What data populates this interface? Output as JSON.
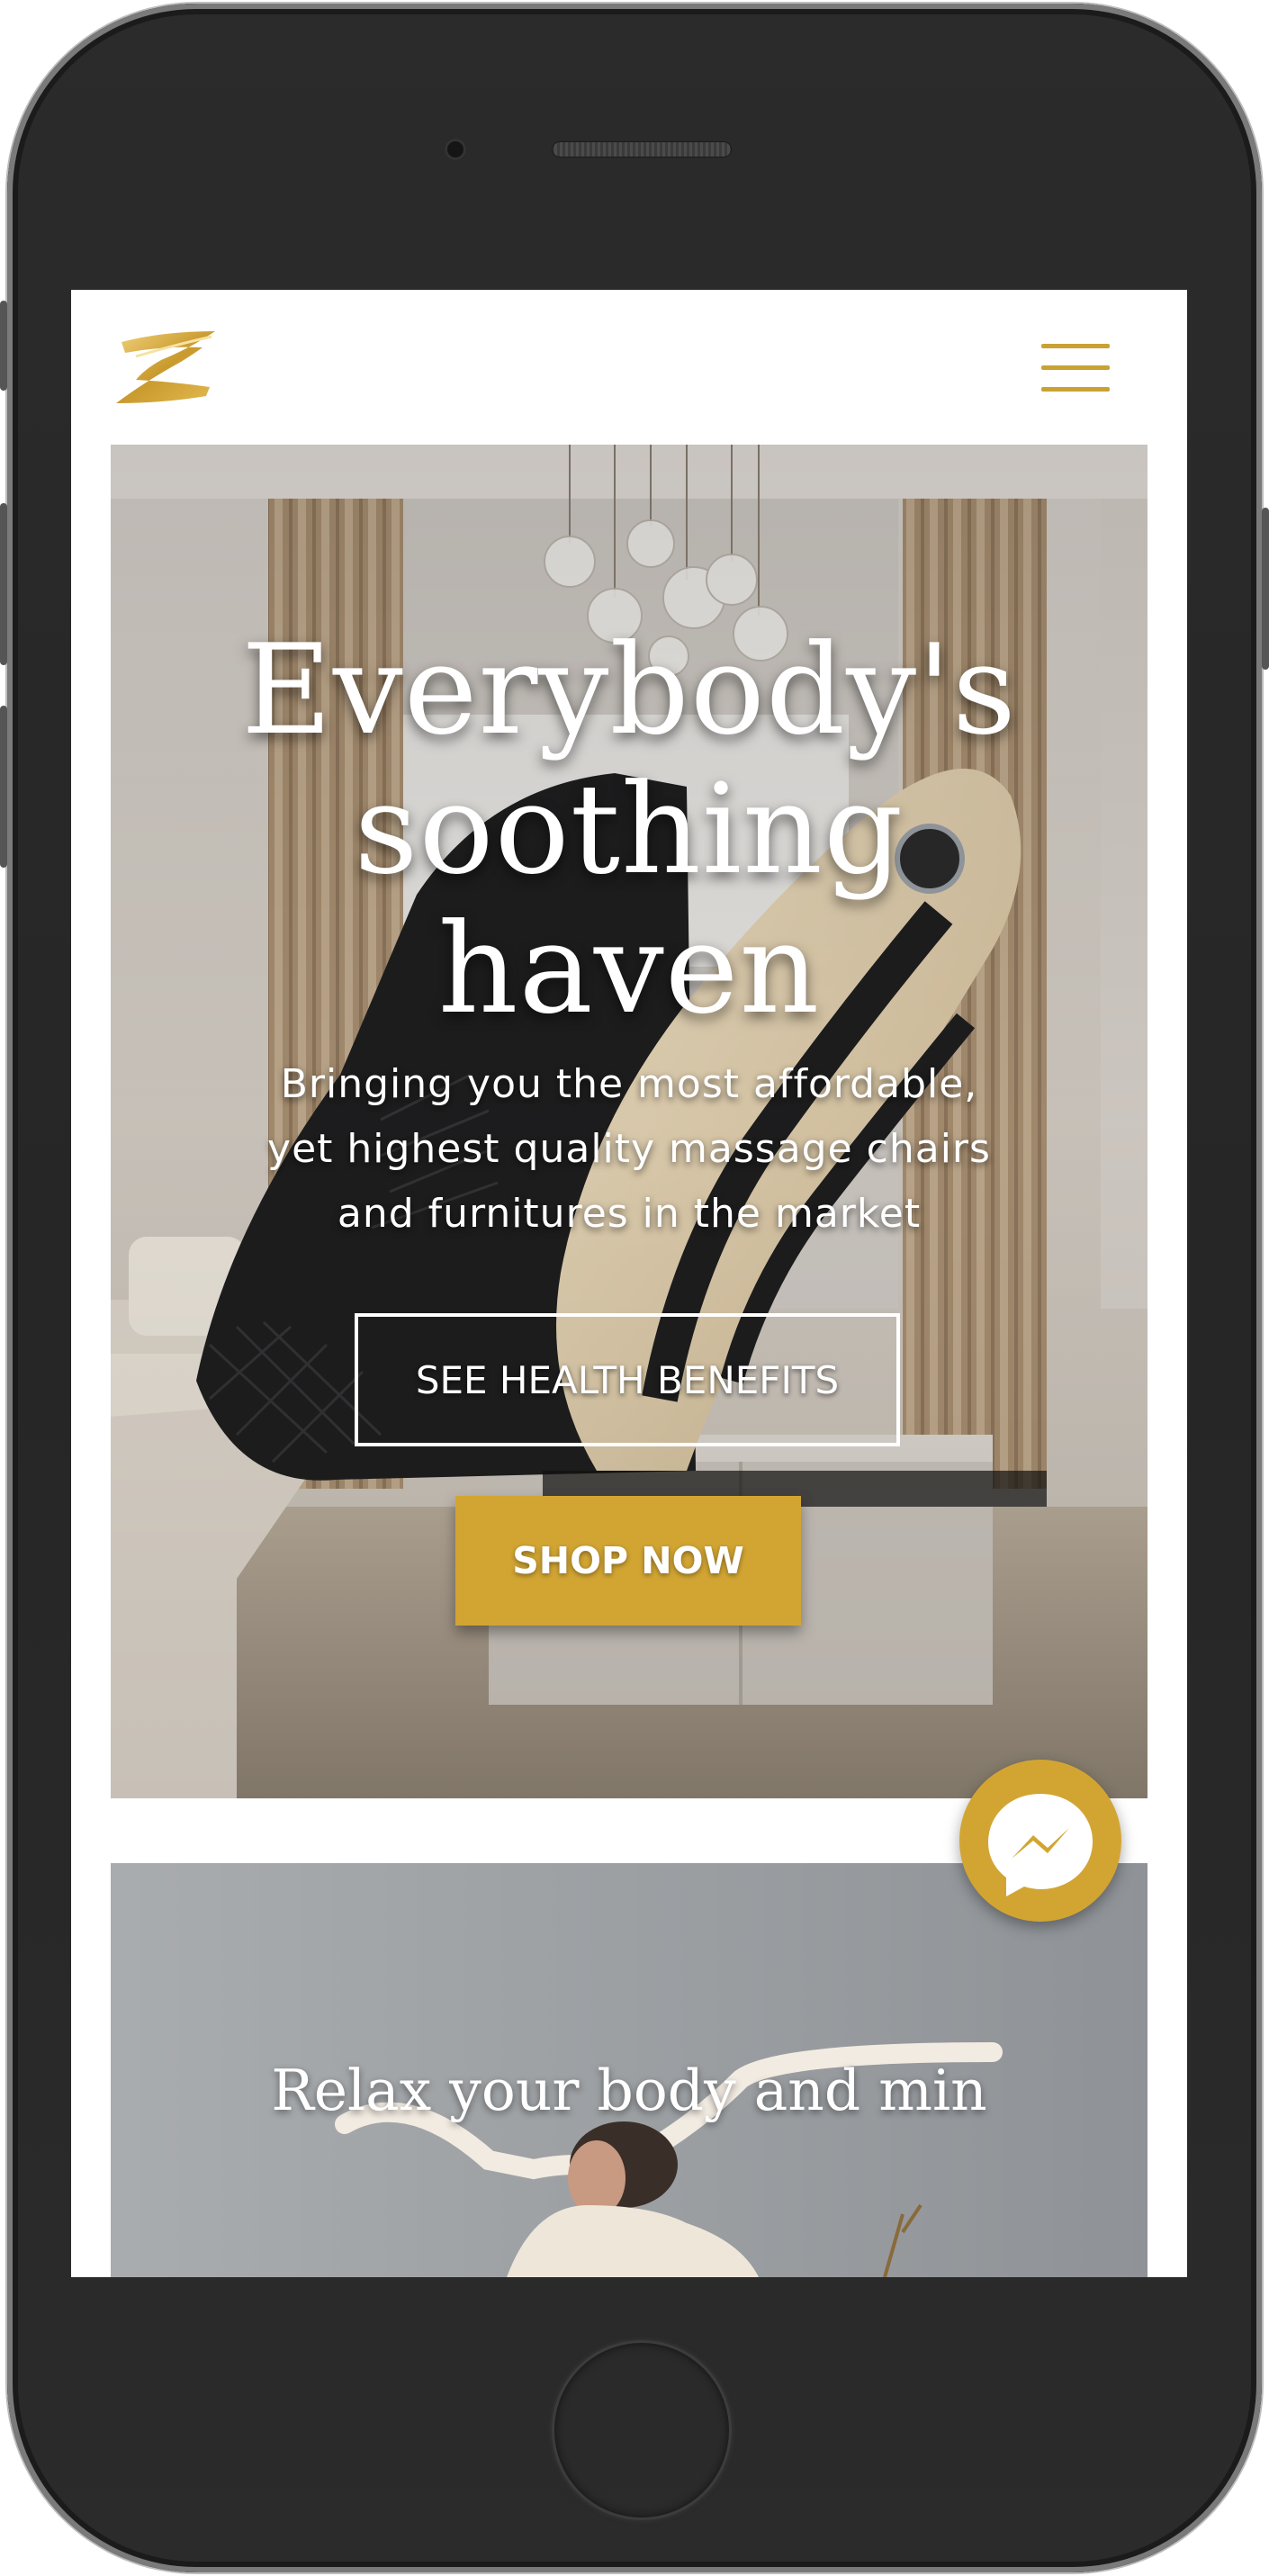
{
  "colors": {
    "accent": "#d2a533",
    "hamburger": "#c9a233",
    "hero_text": "#ffffff"
  },
  "header": {
    "logo_icon": "z-logo-icon",
    "menu_icon": "hamburger-menu-icon"
  },
  "hero": {
    "title_line1": "Everybody's",
    "title_line2": "soothing",
    "title_line3": "haven",
    "subtitle_line1": "Bringing you the most affordable,",
    "subtitle_line2": "yet highest quality massage chairs",
    "subtitle_line3": "and furnitures in the market",
    "secondary_button": "SEE HEALTH BENEFITS",
    "primary_button": "SHOP NOW"
  },
  "section2": {
    "title": "Relax your body and min"
  },
  "chat": {
    "icon": "messenger-icon"
  }
}
